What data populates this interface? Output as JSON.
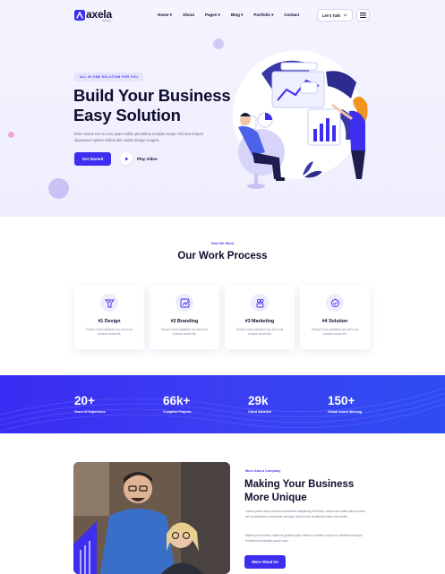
{
  "brand": {
    "name": "axela",
    "tagline": "business"
  },
  "nav": {
    "items": [
      {
        "label": "Home"
      },
      {
        "label": "About"
      },
      {
        "label": "Pages"
      },
      {
        "label": "Blog"
      },
      {
        "label": "Portfolio"
      },
      {
        "label": "Contact"
      }
    ],
    "cta_label": "Let's Talk"
  },
  "hero": {
    "tag": "ALL IN ONE SOLUTION FOR YOU",
    "title_line1": "Build Your Business",
    "title_line2": "Easy Solution",
    "description": "Enim luctus eos in cum quam sollitu penatibus sedadiu neque nisi duo tempor aliquesam optaris sollicitudin mattis Integer magnis.",
    "primary_button": "Get Started",
    "secondary_button": "Play Video"
  },
  "process": {
    "eyebrow": "How We Work",
    "title": "Our Work Process",
    "cards": [
      {
        "title": "#1 Design",
        "desc": "Tempor lorus sodaleset con alsi ocus turcase ornare life",
        "icon": "design-icon"
      },
      {
        "title": "#2 Branding",
        "desc": "Tempor lorus sodaleset con alsi ocus turcase ornare life",
        "icon": "branding-icon"
      },
      {
        "title": "#3 Marketing",
        "desc": "Tempor lorus sodaleset con alsi ocus turcase ornare life",
        "icon": "marketing-icon"
      },
      {
        "title": "#4 Solution",
        "desc": "Tempor lorus sodaleset con alsi ocus turcase ornare life",
        "icon": "solution-icon"
      }
    ]
  },
  "stats": [
    {
      "value": "20+",
      "label": "Years Of Experience"
    },
    {
      "value": "66k+",
      "label": "Complete Projects"
    },
    {
      "value": "29k",
      "label": "Client Satisfied"
    },
    {
      "value": "150+",
      "label": "Global Award Winning"
    }
  ],
  "about": {
    "eyebrow": "More About Company",
    "title_line1": "Making Your Business",
    "title_line2": "More Unique",
    "paragraph1": "Lorem ipsum dolor sit amet consectetur adipiscing elit luctus, luctus nisi mattis purus ornare vel condimentum consequat sociosqu velit elit nisi vestibulum lacus nec mollis.",
    "paragraph2": "Massa ipsum tortor, mattis et gravida quam dictum, curabitur neque non facilisis est turpis fermentum phasellus quam nunc.",
    "button": "More About Us"
  },
  "colors": {
    "accent": "#3d2ef0",
    "dark": "#0f0d2e",
    "hero_bg": "#f1f0fd",
    "stats_bg": "#3b35f2"
  }
}
